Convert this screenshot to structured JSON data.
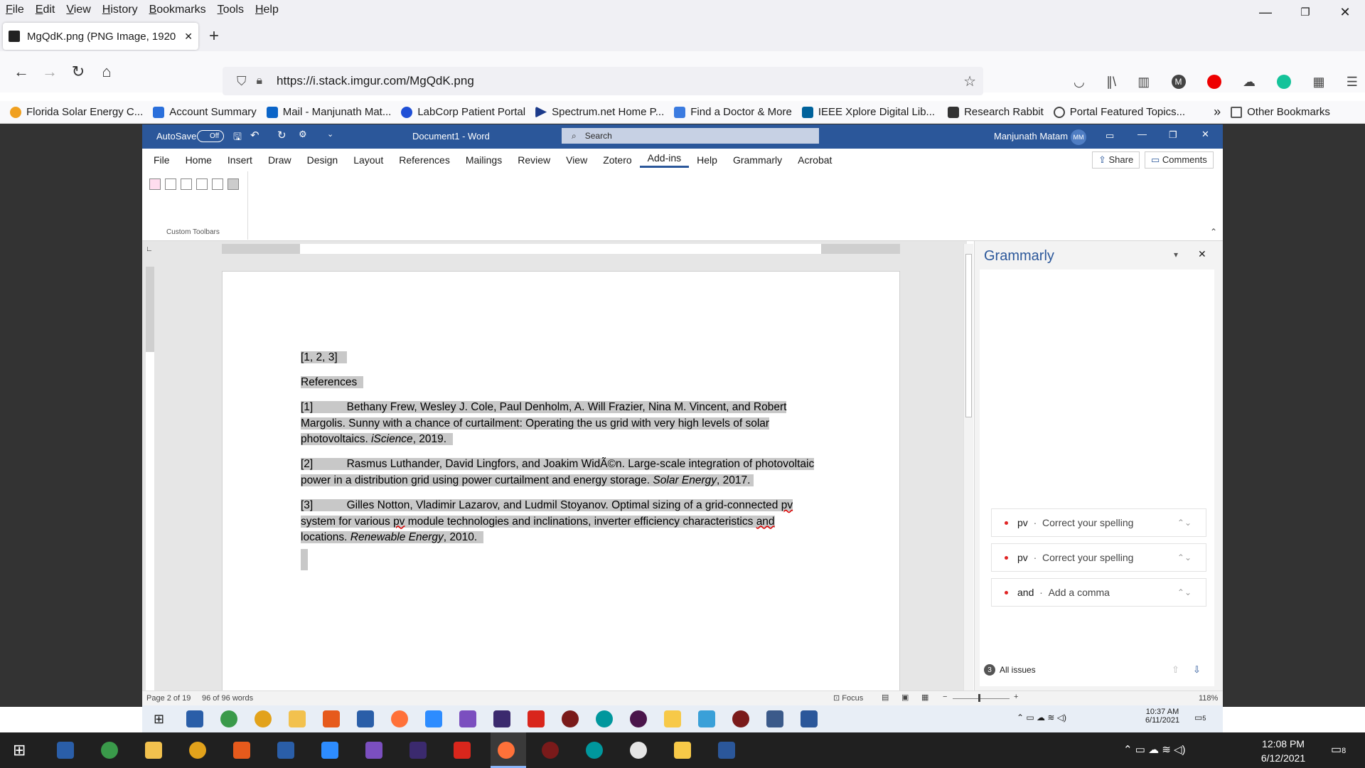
{
  "browser": {
    "menu": [
      "File",
      "Edit",
      "View",
      "History",
      "Bookmarks",
      "Tools",
      "Help"
    ],
    "tab_title": "MgQdK.png (PNG Image, 1920",
    "url": "https://i.stack.imgur.com/MgQdK.png",
    "bookmarks": [
      "Florida Solar Energy C...",
      "Account Summary",
      "Mail - Manjunath Mat...",
      "LabCorp Patient Portal",
      "Spectrum.net Home P...",
      "Find a Doctor & More",
      "IEEE Xplore Digital Lib...",
      "Research Rabbit",
      "Portal Featured Topics..."
    ],
    "other_bookmarks": "Other Bookmarks"
  },
  "word": {
    "autosave": "AutoSave",
    "autosave_state": "Off",
    "doc_title": "Document1  -  Word",
    "search_placeholder": "Search",
    "user": "Manjunath Matam",
    "initials": "MM",
    "tabs": [
      "File",
      "Home",
      "Insert",
      "Draw",
      "Design",
      "Layout",
      "References",
      "Mailings",
      "Review",
      "View",
      "Zotero",
      "Add-ins",
      "Help",
      "Grammarly",
      "Acrobat"
    ],
    "active_tab": "Add-ins",
    "share": "Share",
    "comments": "Comments",
    "group_label": "Custom Toolbars",
    "doc": {
      "citation": "[1, 2, 3]",
      "heading": "References",
      "ref1_num": "[1]",
      "ref1_a": "Bethany Frew, Wesley J. Cole, Paul Denholm, A. Will Frazier, Nina M. Vincent, and Robert",
      "ref1_b": "Margolis. Sunny with a chance of curtailment: Operating the us grid with very high levels of solar",
      "ref1_c1": "photovoltaics. ",
      "ref1_c2": "iScience",
      "ref1_c3": ", 2019.",
      "ref2_num": "[2]",
      "ref2_a": "Rasmus Luthander, David Lingfors, and Joakim WidÃ©n. Large-scale integration of photovoltaic",
      "ref2_b1": "power in a distribution grid using power curtailment and energy storage. ",
      "ref2_b2": "Solar Energy",
      "ref2_b3": ", 2017.",
      "ref3_num": "[3]",
      "ref3_a1": "Gilles Notton, Vladimir Lazarov, and Ludmil Stoyanov. Optimal sizing of a grid-connected ",
      "ref3_a2": "pv",
      "ref3_b1": "system for various ",
      "ref3_b2": "pv",
      "ref3_b3": " module technologies and inclinations, inverter efficiency characteristics ",
      "ref3_b4": "and",
      "ref3_c1": "locations. ",
      "ref3_c2": "Renewable Energy",
      "ref3_c3": ", 2010."
    },
    "grammarly": {
      "title": "Grammarly",
      "issues": [
        {
          "word": "pv",
          "sep": "·",
          "action": "Correct your spelling"
        },
        {
          "word": "pv",
          "sep": "·",
          "action": "Correct your spelling"
        },
        {
          "word": "and",
          "sep": "·",
          "action": "Add a comma"
        }
      ],
      "count": "3",
      "all_issues": "All issues"
    },
    "status": {
      "page": "Page 2 of 19",
      "words": "96 of 96 words",
      "focus": "Focus",
      "zoom": "118%"
    }
  },
  "taskbar_inner": {
    "time": "10:37 AM",
    "date": "6/11/2021",
    "notif": "5"
  },
  "taskbar_outer": {
    "time": "12:08 PM",
    "date": "6/12/2021",
    "notif": "8"
  }
}
